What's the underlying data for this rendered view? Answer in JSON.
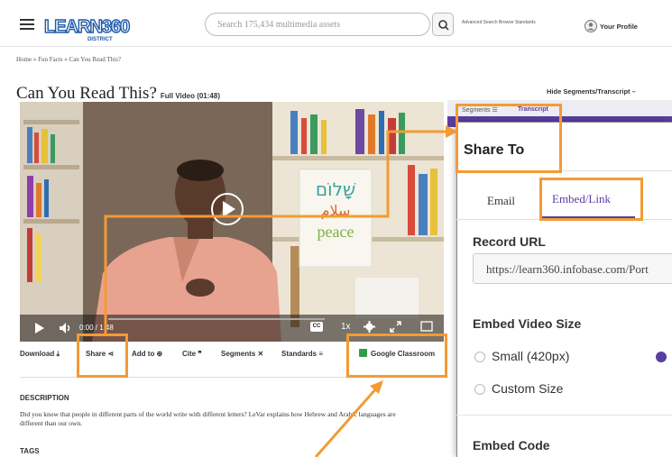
{
  "header": {
    "logo_text": "LEARN360",
    "logo_sub": "DISTRICT",
    "search_placeholder": "Search 175,434 multimedia assets",
    "links": "Advanced Search  Browse  Standards",
    "profile": "Your Profile"
  },
  "breadcrumb": "Home » Fun Facts » Can You Read This?",
  "video": {
    "title": "Can You Read This?",
    "subtitle": "Full Video (01:48)",
    "time": "0:00 / 1:48",
    "speed": "1x",
    "cc": "CC",
    "board_lines": [
      "שָׁלוֹם",
      "سلام",
      "peace"
    ]
  },
  "hide_segments": "Hide Segments/Transcript –",
  "segments_tabs": {
    "segments": "Segments ☰",
    "transcript": "Transcript"
  },
  "toolbar": {
    "download": "Download ⤓",
    "share": "Share ⋖",
    "add_to": "Add to ⊕",
    "cite": "Cite ❞",
    "segments": "Segments ✕",
    "standards": "Standards ≡",
    "google": "Google Classroom"
  },
  "description": {
    "heading": "DESCRIPTION",
    "text": "Did you know that people in different parts of the world write with different letters? LeVar explains how Hebrew and Arabic languages are different than our own.",
    "tags_heading": "TAGS"
  },
  "share_panel": {
    "title": "Share To",
    "tab_email": "Email",
    "tab_embed": "Embed/Link",
    "record_url_label": "Record URL",
    "record_url": "https://learn360.infobase.com/Port",
    "embed_size_label": "Embed Video Size",
    "small": "Small (420px)",
    "custom": "Custom Size",
    "embed_code_label": "Embed Code"
  },
  "colors": {
    "accent": "#5a3e9e",
    "annotation": "#f39b34"
  }
}
